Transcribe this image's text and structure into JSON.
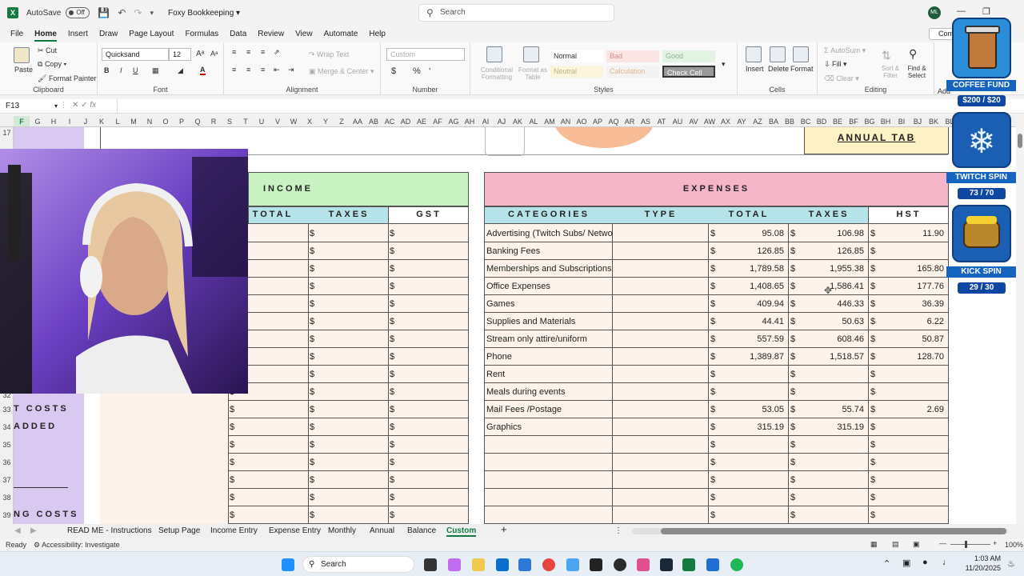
{
  "titlebar": {
    "autosave_label": "AutoSave",
    "autosave_state": "Off",
    "doc_title": "Foxy Bookkeeping",
    "search_placeholder": "Search",
    "user_initials": "ML",
    "comments_label": "Comm"
  },
  "menu": [
    "File",
    "Home",
    "Insert",
    "Draw",
    "Page Layout",
    "Formulas",
    "Data",
    "Review",
    "View",
    "Automate",
    "Help"
  ],
  "ribbon": {
    "paste": "Paste",
    "cut": "Cut",
    "copy": "Copy",
    "format_painter": "Format Painter",
    "clipboard": "Clipboard",
    "font_name": "Quicksand",
    "font_size": "12",
    "font_group": "Font",
    "wrap_text": "Wrap Text",
    "merge_center": "Merge & Center",
    "alignment_group": "Alignment",
    "number_format": "Custom",
    "number_group": "Number",
    "conditional_formatting": "Conditional Formatting",
    "format_as_table": "Format as Table",
    "style_normal": "Normal",
    "style_bad": "Bad",
    "style_good": "Good",
    "style_neutral": "Neutral",
    "style_calculation": "Calculation",
    "style_check_cell": "Check Cell",
    "styles_group": "Styles",
    "insert": "Insert",
    "delete": "Delete",
    "format": "Format",
    "cells_group": "Cells",
    "autosum": "AutoSum",
    "fill": "Fill",
    "clear": "Clear",
    "sort_filter": "Sort & Filter",
    "find_select": "Find & Select",
    "editing_group": "Editing",
    "addins_group": "Add"
  },
  "formula_bar": {
    "name_box": "F13",
    "fx": "fx"
  },
  "columns": [
    "F",
    "G",
    "H",
    "I",
    "J",
    "K",
    "L",
    "M",
    "N",
    "O",
    "P",
    "Q",
    "R",
    "S",
    "T",
    "U",
    "V",
    "W",
    "X",
    "Y",
    "Z",
    "AA",
    "AB",
    "AC",
    "AD",
    "AE",
    "AF",
    "AG",
    "AH",
    "AI",
    "AJ",
    "AK",
    "AL",
    "AM",
    "AN",
    "AO",
    "AP",
    "AQ",
    "AR",
    "AS",
    "AT",
    "AU",
    "AV",
    "AW",
    "AX",
    "AY",
    "AZ",
    "BA",
    "BB",
    "BC",
    "BD",
    "BE",
    "BF",
    "BG",
    "BH",
    "BI",
    "BJ",
    "BK",
    "BL"
  ],
  "rows": [
    "17",
    "32",
    "33",
    "34",
    "35",
    "36",
    "37",
    "38",
    "39"
  ],
  "sheet": {
    "annual_tab": "ANNUAL TAB",
    "income_title": "INCOME",
    "income_headers": [
      "TOTAL",
      "TAXES",
      "GST"
    ],
    "expenses_title": "EXPENSES",
    "expense_headers": [
      "CATEGORIES",
      "TYPE",
      "TOTAL",
      "TAXES",
      "HST"
    ],
    "left_labels": [
      "T COSTS",
      "ADDED",
      "NG COSTS"
    ],
    "currency": "$",
    "expenses": [
      {
        "category": "Advertising (Twitch Subs/ Network",
        "total": "95.08",
        "taxes": "106.98",
        "hst": "11.90"
      },
      {
        "category": "Banking Fees",
        "total": "126.85",
        "taxes": "126.85",
        "hst": ""
      },
      {
        "category": "Memberships and Subscriptions",
        "total": "1,789.58",
        "taxes": "1,955.38",
        "hst": "165.80"
      },
      {
        "category": "Office Expenses",
        "total": "1,408.65",
        "taxes": "1,586.41",
        "hst": "177.76"
      },
      {
        "category": "Games",
        "total": "409.94",
        "taxes": "446.33",
        "hst": "36.39"
      },
      {
        "category": "Supplies and Materials",
        "total": "44.41",
        "taxes": "50.63",
        "hst": "6.22"
      },
      {
        "category": "Stream only attire/uniform",
        "total": "557.59",
        "taxes": "608.46",
        "hst": "50.87"
      },
      {
        "category": "Phone",
        "total": "1,389.87",
        "taxes": "1,518.57",
        "hst": "128.70"
      },
      {
        "category": "Rent",
        "total": "",
        "taxes": "",
        "hst": ""
      },
      {
        "category": "Meals during events",
        "total": "",
        "taxes": "",
        "hst": ""
      },
      {
        "category": "Mail Fees /Postage",
        "total": "53.05",
        "taxes": "55.74",
        "hst": "2.69"
      },
      {
        "category": "Graphics",
        "total": "315.19",
        "taxes": "315.19",
        "hst": ""
      },
      {
        "category": "",
        "total": "",
        "taxes": "",
        "hst": ""
      },
      {
        "category": "",
        "total": "",
        "taxes": "",
        "hst": ""
      },
      {
        "category": "",
        "total": "",
        "taxes": "",
        "hst": ""
      },
      {
        "category": "",
        "total": "",
        "taxes": "",
        "hst": ""
      },
      {
        "category": "",
        "total": "",
        "taxes": "",
        "hst": ""
      }
    ]
  },
  "overlay": {
    "coffee_label": "COFFEE FUND",
    "coffee_value": "$200 / $20",
    "twitch_label": "TWITCH SPIN",
    "twitch_value": "73 / 70",
    "kick_label": "KICK SPIN",
    "kick_value": "29 / 30"
  },
  "sheet_tabs": [
    "READ ME - Instructions",
    "Setup Page",
    "Income Entry",
    "Expense Entry",
    "Monthly",
    "Annual",
    "Balance",
    "Custom"
  ],
  "active_tab": "Custom",
  "status": {
    "ready": "Ready",
    "accessibility": "Accessibility: Investigate",
    "zoom": "100%"
  },
  "taskbar": {
    "search": "Search",
    "time": "1:03 AM",
    "date": "11/20/2025"
  },
  "colors": {
    "excel_green": "#107c41",
    "income_header": "#c9f2c2",
    "expenses_header": "#f4b6c8",
    "col_header_teal": "#b6e3e9",
    "cell_bg": "#fdf3ea",
    "purple_band": "#d9c8f0",
    "annual_tab_bg": "#fdf1c6"
  }
}
